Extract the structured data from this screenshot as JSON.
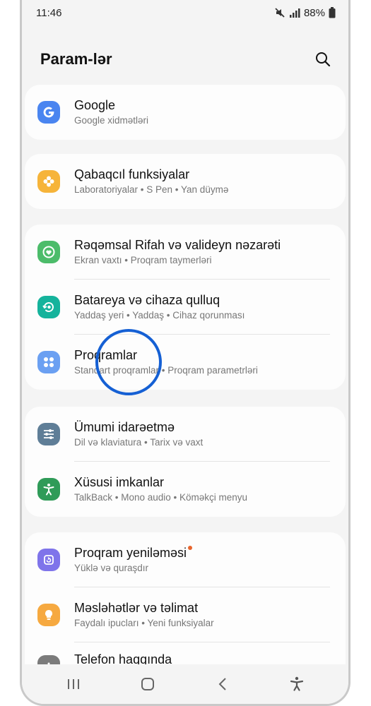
{
  "status": {
    "time": "11:46",
    "battery": "88%",
    "icons": [
      "mute-icon",
      "signal-icon",
      "battery-icon"
    ]
  },
  "header": {
    "title": "Param-lər",
    "search_icon": "search-icon"
  },
  "items": {
    "google": {
      "title": "Google",
      "subtitle": "Google xidmətləri",
      "color": "#4a85f0"
    },
    "advanced": {
      "title": "Qabaqcıl funksiyalar",
      "subtitle": "Laboratoriyalar  •  S Pen  •  Yan düymə",
      "color": "#f6b43a"
    },
    "wellbeing": {
      "title": "Rəqəmsal Rifah və valideyn nəzarəti",
      "subtitle": "Ekran vaxtı  •  Proqram taymerləri",
      "color": "#4cbc6a"
    },
    "battery": {
      "title": "Batareya və cihaza qulluq",
      "subtitle": "Yaddaş yeri  •  Yaddaş  •  Cihaz qorunması",
      "color": "#15b39c"
    },
    "apps": {
      "title": "Proqramlar",
      "subtitle": "Standart proqramlar  •  Proqram parametrləri",
      "color": "#6ba0f2"
    },
    "general": {
      "title": "Ümumi idarəetmə",
      "subtitle": "Dil və klaviatura  •  Tarix və vaxt",
      "color": "#5f7e97"
    },
    "accessibility": {
      "title": "Xüsusi imkanlar",
      "subtitle": "TalkBack  •  Mono audio  •  Köməkçi menyu",
      "color": "#2f9b58"
    },
    "update": {
      "title": "Proqram yeniləməsi",
      "subtitle": "Yüklə və quraşdır",
      "color": "#7f74ea"
    },
    "tips": {
      "title": "Məsləhətlər və təlimat",
      "subtitle": "Faydalı ipucları  •  Yeni funksiyalar",
      "color": "#f6a940"
    },
    "about": {
      "title": "Telefon haqqında",
      "color": "#7b7b7b"
    }
  },
  "highlight_color": "#1560d4"
}
